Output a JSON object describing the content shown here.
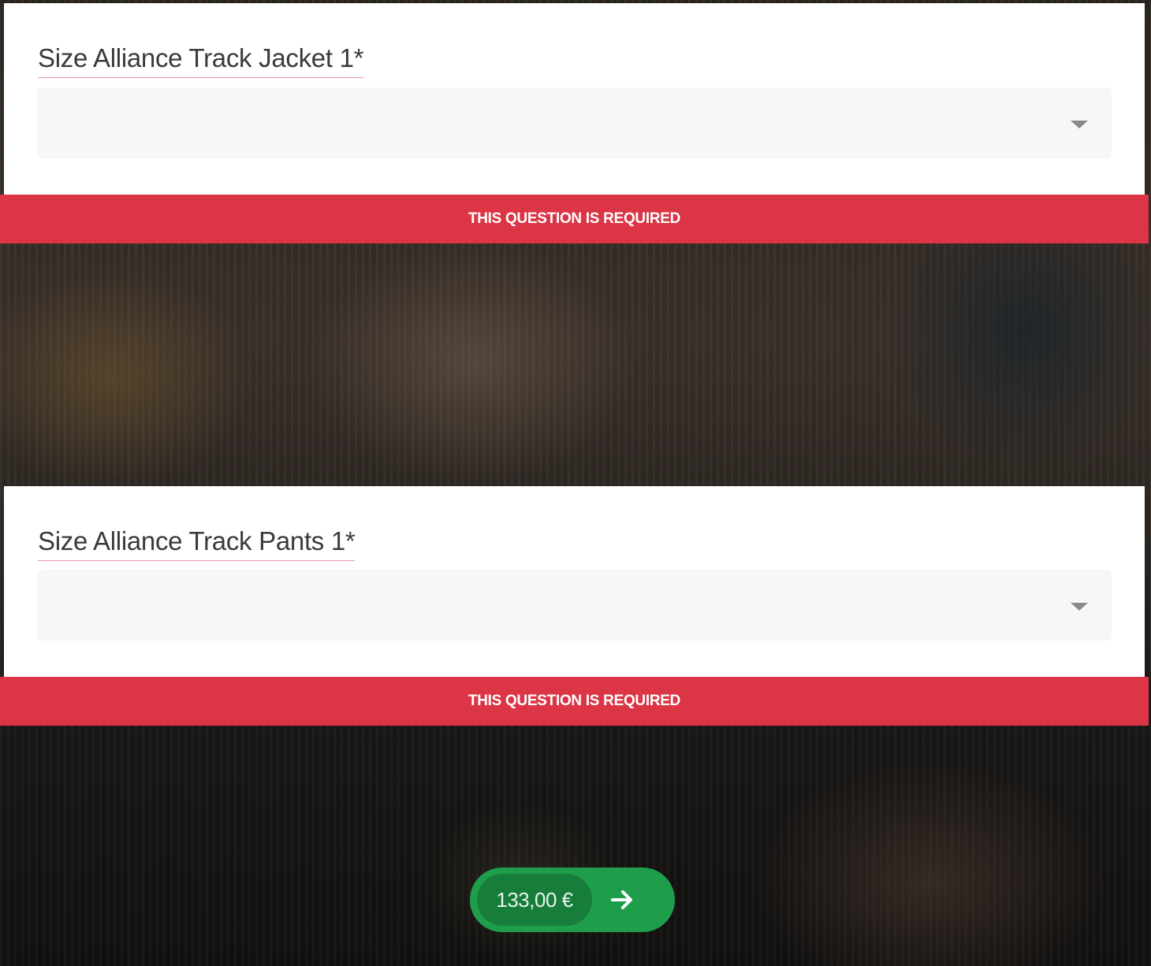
{
  "questions": [
    {
      "label": "Size Alliance Track Jacket 1*",
      "selected_value": "",
      "error": "This question is required"
    },
    {
      "label": "Size Alliance Track Pants 1*",
      "selected_value": "",
      "error": "This question is required"
    }
  ],
  "checkout": {
    "price": "133,00 €",
    "icon": "arrow-right-icon"
  },
  "colors": {
    "error": "#dc3545",
    "button": "#1e9e4a",
    "button_pill": "#177d3a"
  }
}
